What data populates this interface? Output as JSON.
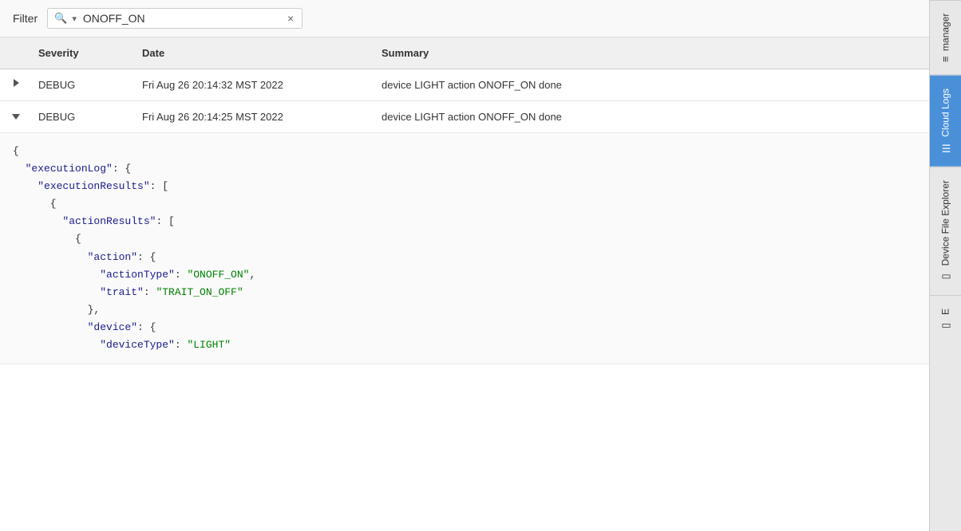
{
  "filter": {
    "label": "Filter",
    "placeholder": "ONOFF_ON",
    "value": "ONOFF_ON",
    "clear_icon": "×",
    "search_icon": "🔍"
  },
  "table": {
    "headers": {
      "expand": "",
      "severity": "Severity",
      "date": "Date",
      "summary": "Summary"
    },
    "rows": [
      {
        "id": "row-1",
        "expanded": false,
        "severity": "DEBUG",
        "date": "Fri Aug 26 20:14:32 MST 2022",
        "summary": "device LIGHT action ONOFF_ON done",
        "detail": null
      },
      {
        "id": "row-2",
        "expanded": true,
        "severity": "DEBUG",
        "date": "Fri Aug 26 20:14:25 MST 2022",
        "summary": "device LIGHT action ONOFF_ON done",
        "detail": "{\n  \"executionLog\": {\n    \"executionResults\": [\n      {\n        \"actionResults\": [\n          {\n            \"action\": {\n              \"actionType\": \"ONOFF_ON\",\n              \"trait\": \"TRAIT_ON_OFF\"\n            },\n            \"device\": {\n              \"deviceType\": \"LIGHT\""
      }
    ]
  },
  "sidebar": {
    "tabs": [
      {
        "id": "manager",
        "label": "manager",
        "icon": "≡",
        "active": false
      },
      {
        "id": "cloud-logs",
        "label": "Cloud Logs",
        "icon": "☰",
        "active": true
      },
      {
        "id": "device-file-explorer",
        "label": "Device File Explorer",
        "icon": "▭",
        "active": false
      },
      {
        "id": "extra",
        "label": "E",
        "icon": "▭",
        "active": false
      }
    ]
  }
}
